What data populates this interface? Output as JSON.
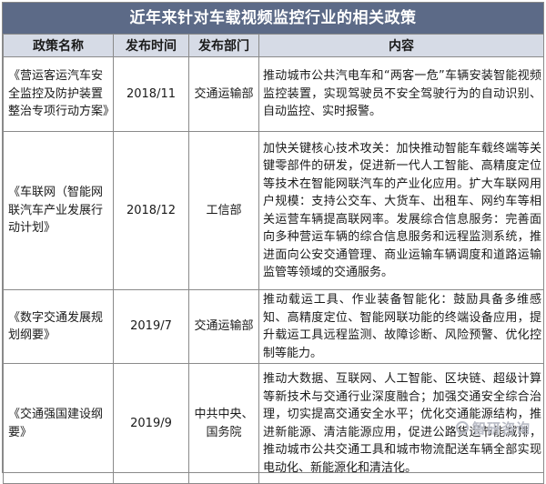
{
  "title": "近年来针对车载视频监控行业的相关政策",
  "headers": [
    "政策名称",
    "发布时间",
    "发布部门",
    "内容"
  ],
  "rows": [
    {
      "name": "《营运客运汽车安全监控及防护装置整治专项行动方案》",
      "date": "2018/11",
      "dept": "交通运输部",
      "content": "推动城市公共汽电车和“两客一危”车辆安装智能视频监控装置，实现驾驶员不安全驾驶行为的自动识别、自动监控、实时报警。"
    },
    {
      "name": "《车联网（智能网联汽车产业发展行动计划》",
      "date": "2018/12",
      "dept": "工信部",
      "content": "加快关键核心技术攻关：加快推动智能车载终端等关键零部件的研发，促进新一代人工智能、高精度定位等技术在智能网联汽车的产业化应用。扩大车联网用户规模：支持公交车、大货车、出租车、网约车等相关运营车辆提高联网率。发展综合信息服务：完善面向多种营运车辆的综合信息服务和远程监测系统，推进面向公安交通管理、商业运输车辆调度和道路运输监管等领域的交通服务。"
    },
    {
      "name": "《数字交通发展规划纲要》",
      "date": "2019/7",
      "dept": "交通运输部",
      "content": "推动载运工具、作业装备智能化：鼓励具备多维感知、高精度定位、智能网联功能的终端设备应用，提升载运工具远程监测、故障诊断、风险预警、优化控制等能力。"
    },
    {
      "name": "《交通强国建设纲要》",
      "date": "2019/9",
      "dept": "中共中央、国务院",
      "content": "推动大数据、互联网、人工智能、区块链、超级计算等新技术与交通行业深度融合；加强交通安全综合治理，切实提高交通安全水平；优化交通能源结构，推进新能源、清洁能源应用，促进公路货运节能减排，推动城市公共交通工具和城市物流配送车辆全部实现电动化、新能源化和清洁化。"
    }
  ],
  "watermark": "智研咨询"
}
